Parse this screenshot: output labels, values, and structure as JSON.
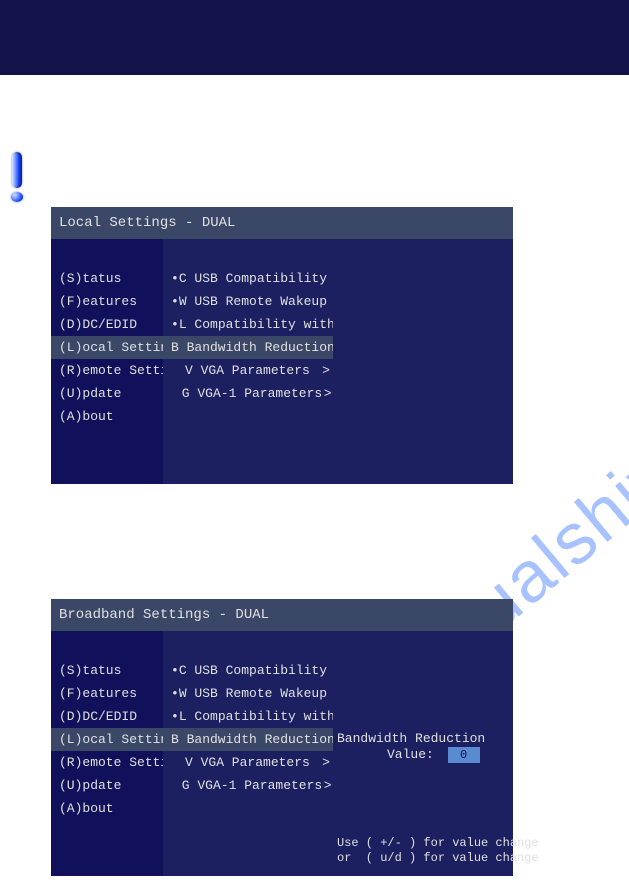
{
  "watermark": "manualshive.com",
  "panels": [
    {
      "title": "Local Settings - DUAL",
      "left_items": [
        {
          "label": "(S)tatus",
          "selected": false
        },
        {
          "label": "(F)eatures",
          "selected": false
        },
        {
          "label": "(D)DC/EDID",
          "selected": false
        },
        {
          "label": "(L)ocal  Settings",
          "selected": true
        },
        {
          "label": "(R)emote Settings",
          "selected": false
        },
        {
          "label": "(U)pdate",
          "selected": false
        },
        {
          "label": "(A)bout",
          "selected": false
        }
      ],
      "mid_items": [
        {
          "bullet": "•",
          "label": "C USB Compatibility Mode",
          "arrow": "",
          "selected": false
        },
        {
          "bullet": "•",
          "label": "W USB Remote Wakeup",
          "arrow": "",
          "selected": false
        },
        {
          "bullet": "•",
          "label": "L Compatibility with Linux",
          "arrow": "",
          "selected": false
        },
        {
          "bullet": "",
          "label": "B Bandwidth Reduction",
          "arrow": ">",
          "selected": true
        },
        {
          "bullet": "",
          "label": "V VGA   Parameters",
          "arrow": ">",
          "selected": false
        },
        {
          "bullet": "",
          "label": "G VGA-1 Parameters",
          "arrow": ">",
          "selected": false
        }
      ],
      "right": null
    },
    {
      "title": "Broadband Settings - DUAL",
      "left_items": [
        {
          "label": "(S)tatus",
          "selected": false
        },
        {
          "label": "(F)eatures",
          "selected": false
        },
        {
          "label": "(D)DC/EDID",
          "selected": false
        },
        {
          "label": "(L)ocal  Settings",
          "selected": true
        },
        {
          "label": "(R)emote Settings",
          "selected": false
        },
        {
          "label": "(U)pdate",
          "selected": false
        },
        {
          "label": "(A)bout",
          "selected": false
        }
      ],
      "mid_items": [
        {
          "bullet": "•",
          "label": "C USB Compatibility Mode",
          "arrow": "",
          "selected": false
        },
        {
          "bullet": "•",
          "label": "W USB Remote Wakeup",
          "arrow": "",
          "selected": false
        },
        {
          "bullet": "•",
          "label": "L Compatibility with Linux",
          "arrow": "",
          "selected": false
        },
        {
          "bullet": "",
          "label": "B Bandwidth Reduction",
          "arrow": ">",
          "selected": true
        },
        {
          "bullet": "",
          "label": "V VGA   Parameters",
          "arrow": ">",
          "selected": false
        },
        {
          "bullet": "",
          "label": "G VGA-1 Parameters",
          "arrow": ">",
          "selected": false
        }
      ],
      "right": {
        "label": "Bandwidth Reduction",
        "value_label": "Value:",
        "value": "0",
        "help": "Use ( +/- ) for value change\nor  ( u/d ) for value change"
      }
    }
  ]
}
